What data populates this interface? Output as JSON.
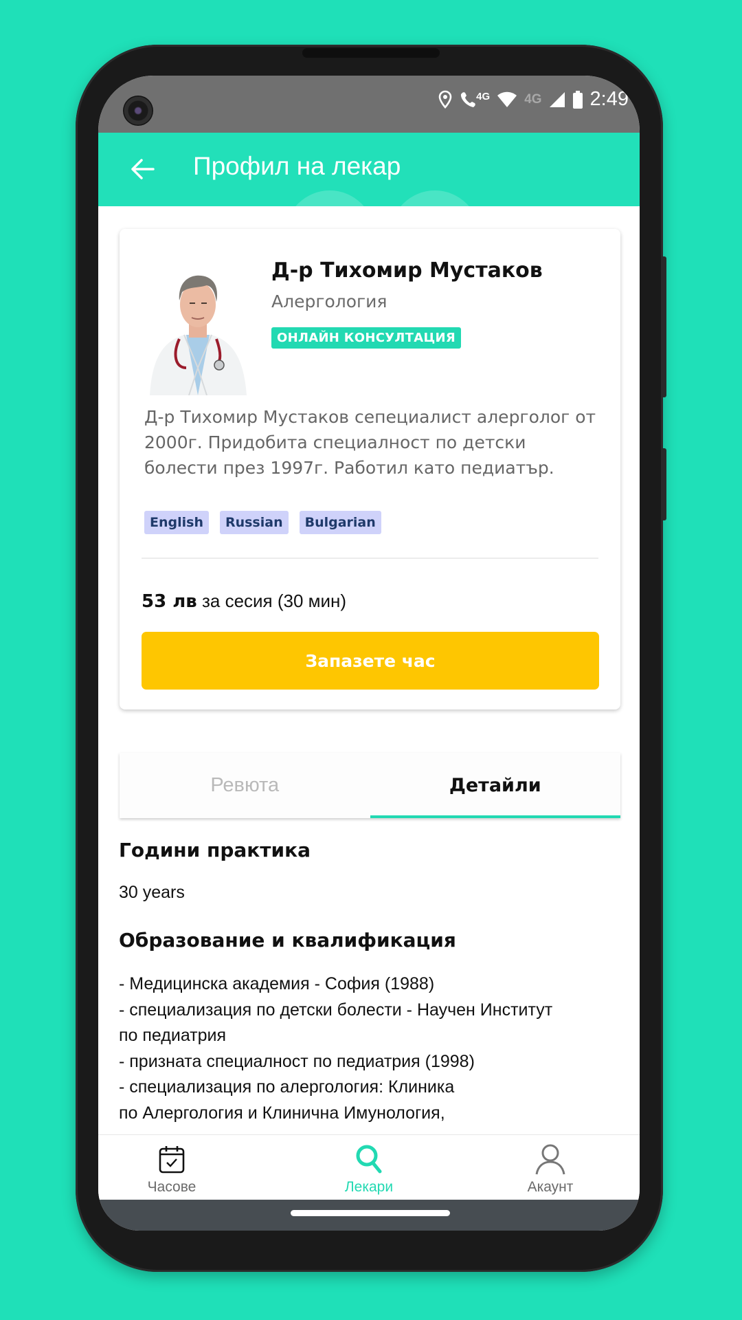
{
  "status_bar": {
    "time": "2:49",
    "net_call_label": "4G",
    "net_data_label": "4G",
    "icons": [
      "location-icon",
      "volte-call-icon",
      "wifi-icon",
      "cell-signal-icon",
      "battery-icon"
    ]
  },
  "app_bar": {
    "title": "Профил на лекар",
    "back_icon": "arrow-left-icon"
  },
  "doctor": {
    "name": "Д-р Тихомир Мустаков",
    "specialty": "Алергология",
    "badge": "ОНЛАЙН КОНСУЛТАЦИЯ",
    "bio": "Д-р Тихомир Мустаков сепециалист  алерголог от 2000г. Придобита специалност по детски болести през 1997г. Работил като педиатър.",
    "languages": [
      "English",
      "Russian",
      "Bulgarian"
    ],
    "price_amount": "53 лв",
    "price_suffix": " за сесия (30 мин)",
    "book_button": "Запазете час"
  },
  "tabs": [
    {
      "label": "Ревюта",
      "active": false
    },
    {
      "label": "Детайли",
      "active": true
    }
  ],
  "details": {
    "practice_title": "Години практика",
    "practice_value": "30 years",
    "education_title": "Образование и квалификация",
    "education_lines": [
      "- Медицинска академия - София (1988)",
      "- специализация по детски болести - Научен Институт",
      "по педиатрия",
      "- призната специалност по педиатрия (1998)",
      "- специализация по алергология: Клиника",
      "по Алергология и Клинична Имунология,"
    ]
  },
  "bottom_nav": [
    {
      "label": "Часове",
      "icon": "calendar-check-icon",
      "active": false
    },
    {
      "label": "Лекари",
      "icon": "search-icon",
      "active": true
    },
    {
      "label": "Акаунт",
      "icon": "user-icon",
      "active": false
    }
  ],
  "colors": {
    "accent": "#22d9b2",
    "background": "#1fe0b8",
    "button": "#fec601",
    "language_chip": "#cfd2fa"
  }
}
